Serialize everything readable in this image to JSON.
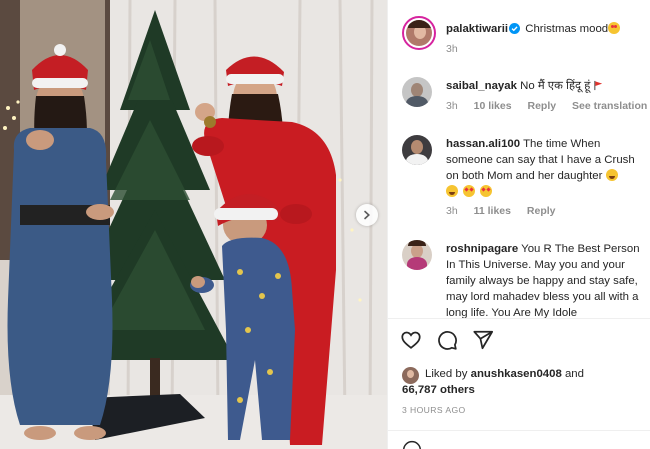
{
  "post": {
    "author": "palaktiwarii",
    "caption": "Christmas mood",
    "time": "3h"
  },
  "comments": [
    {
      "user": "saibal_nayak",
      "text": "No मैं एक हिंदू हूं",
      "time": "3h",
      "likes": "10 likes",
      "reply": "Reply",
      "translate": "See translation"
    },
    {
      "user": "hassan.ali100",
      "text": "The time When someone can say that I have a Crush on both Mom and her daughter",
      "time": "3h",
      "likes": "11 likes",
      "reply": "Reply"
    },
    {
      "user": "roshnipagare",
      "text": "You R The Best Person In This Universe. May you and your family always be happy and stay safe, may lord mahadev bless you all with a long life. You Are My Idole"
    }
  ],
  "liked_by": {
    "prefix": "Liked by",
    "user": "anushkasen0408",
    "and": "and",
    "others": "66,787 others"
  },
  "posted_ago": "3 HOURS AGO",
  "icons": {
    "like": "heart-icon",
    "comment": "comment-icon",
    "share": "share-icon",
    "next": "chevron-right-icon",
    "verified": "verified-badge-icon",
    "flag": "red-flag-icon"
  },
  "colors": {
    "text": "#262626",
    "muted": "#8e8e8e",
    "verified": "#0095f6",
    "ring": "#d6249f"
  }
}
